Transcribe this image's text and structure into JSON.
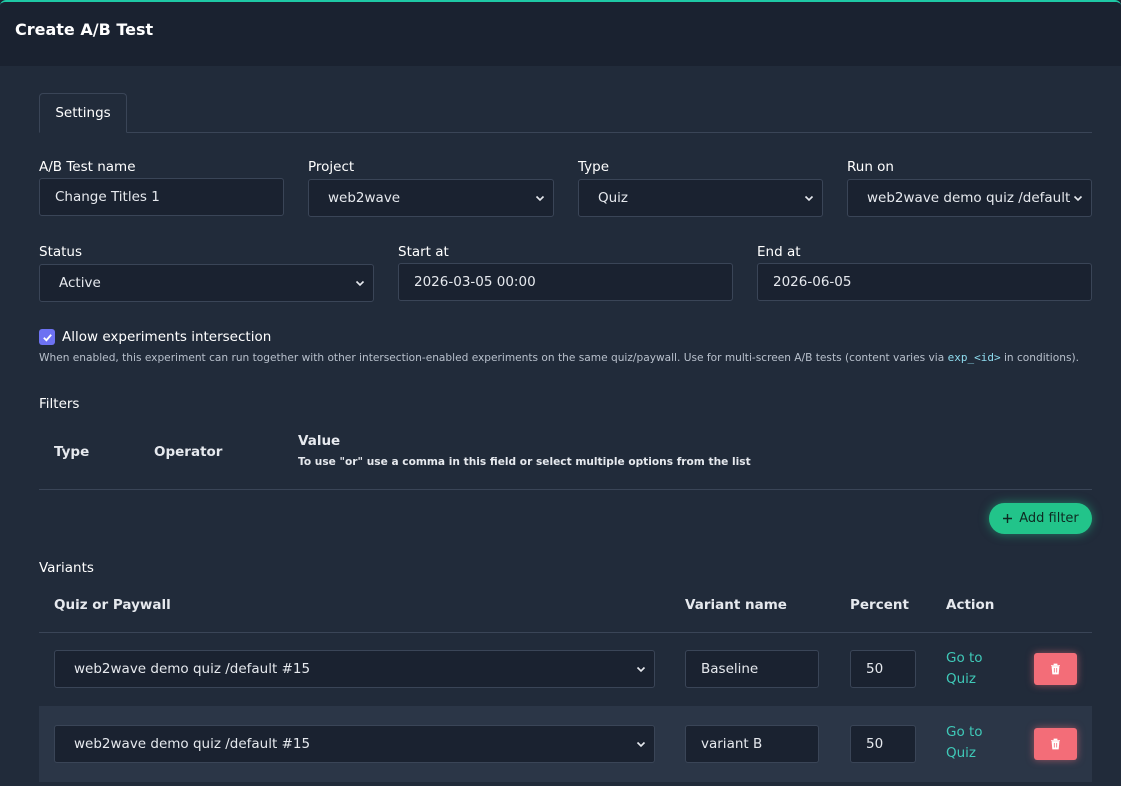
{
  "header": {
    "title": "Create A/B Test"
  },
  "tabs": [
    {
      "label": "Settings"
    }
  ],
  "form": {
    "name": {
      "label": "A/B Test name",
      "value": "Change Titles 1"
    },
    "project": {
      "label": "Project",
      "value": "web2wave"
    },
    "type": {
      "label": "Type",
      "value": "Quiz"
    },
    "run_on": {
      "label": "Run on",
      "value": "web2wave demo quiz /default"
    },
    "status": {
      "label": "Status",
      "value": "Active"
    },
    "start_at": {
      "label": "Start at",
      "value": "2026-03-05 00:00"
    },
    "end_at": {
      "label": "End at",
      "value": "2026-06-05"
    },
    "intersection": {
      "label": "Allow experiments intersection",
      "checked": true,
      "help_before": "When enabled, this experiment can run together with other intersection-enabled experiments on the same quiz/paywall. Use for multi-screen A/B tests (content varies via ",
      "help_code": "exp_<id>",
      "help_after": " in conditions)."
    }
  },
  "filters": {
    "title": "Filters",
    "columns": {
      "type": "Type",
      "operator": "Operator",
      "value": "Value"
    },
    "value_hint": "To use \"or\" use a comma in this field or select multiple options from the list",
    "add_label": "Add filter",
    "add_icon": "plus-icon"
  },
  "variants": {
    "title": "Variants",
    "columns": {
      "quiz": "Quiz or Paywall",
      "name": "Variant name",
      "percent": "Percent",
      "action": "Action"
    },
    "rows": [
      {
        "quiz": "web2wave demo quiz /default #15",
        "name": "Baseline",
        "percent": "50",
        "link_line1": "Go to",
        "link_line2": "Quiz"
      },
      {
        "quiz": "web2wave demo quiz /default #15",
        "name": "variant B",
        "percent": "50",
        "link_line1": "Go to",
        "link_line2": "Quiz"
      }
    ]
  },
  "colors": {
    "accent": "#1ec8a5",
    "add_button": "#22c48a",
    "delete_button": "#f36d78",
    "checkbox": "#6d72f2",
    "link": "#3fc9b8"
  }
}
